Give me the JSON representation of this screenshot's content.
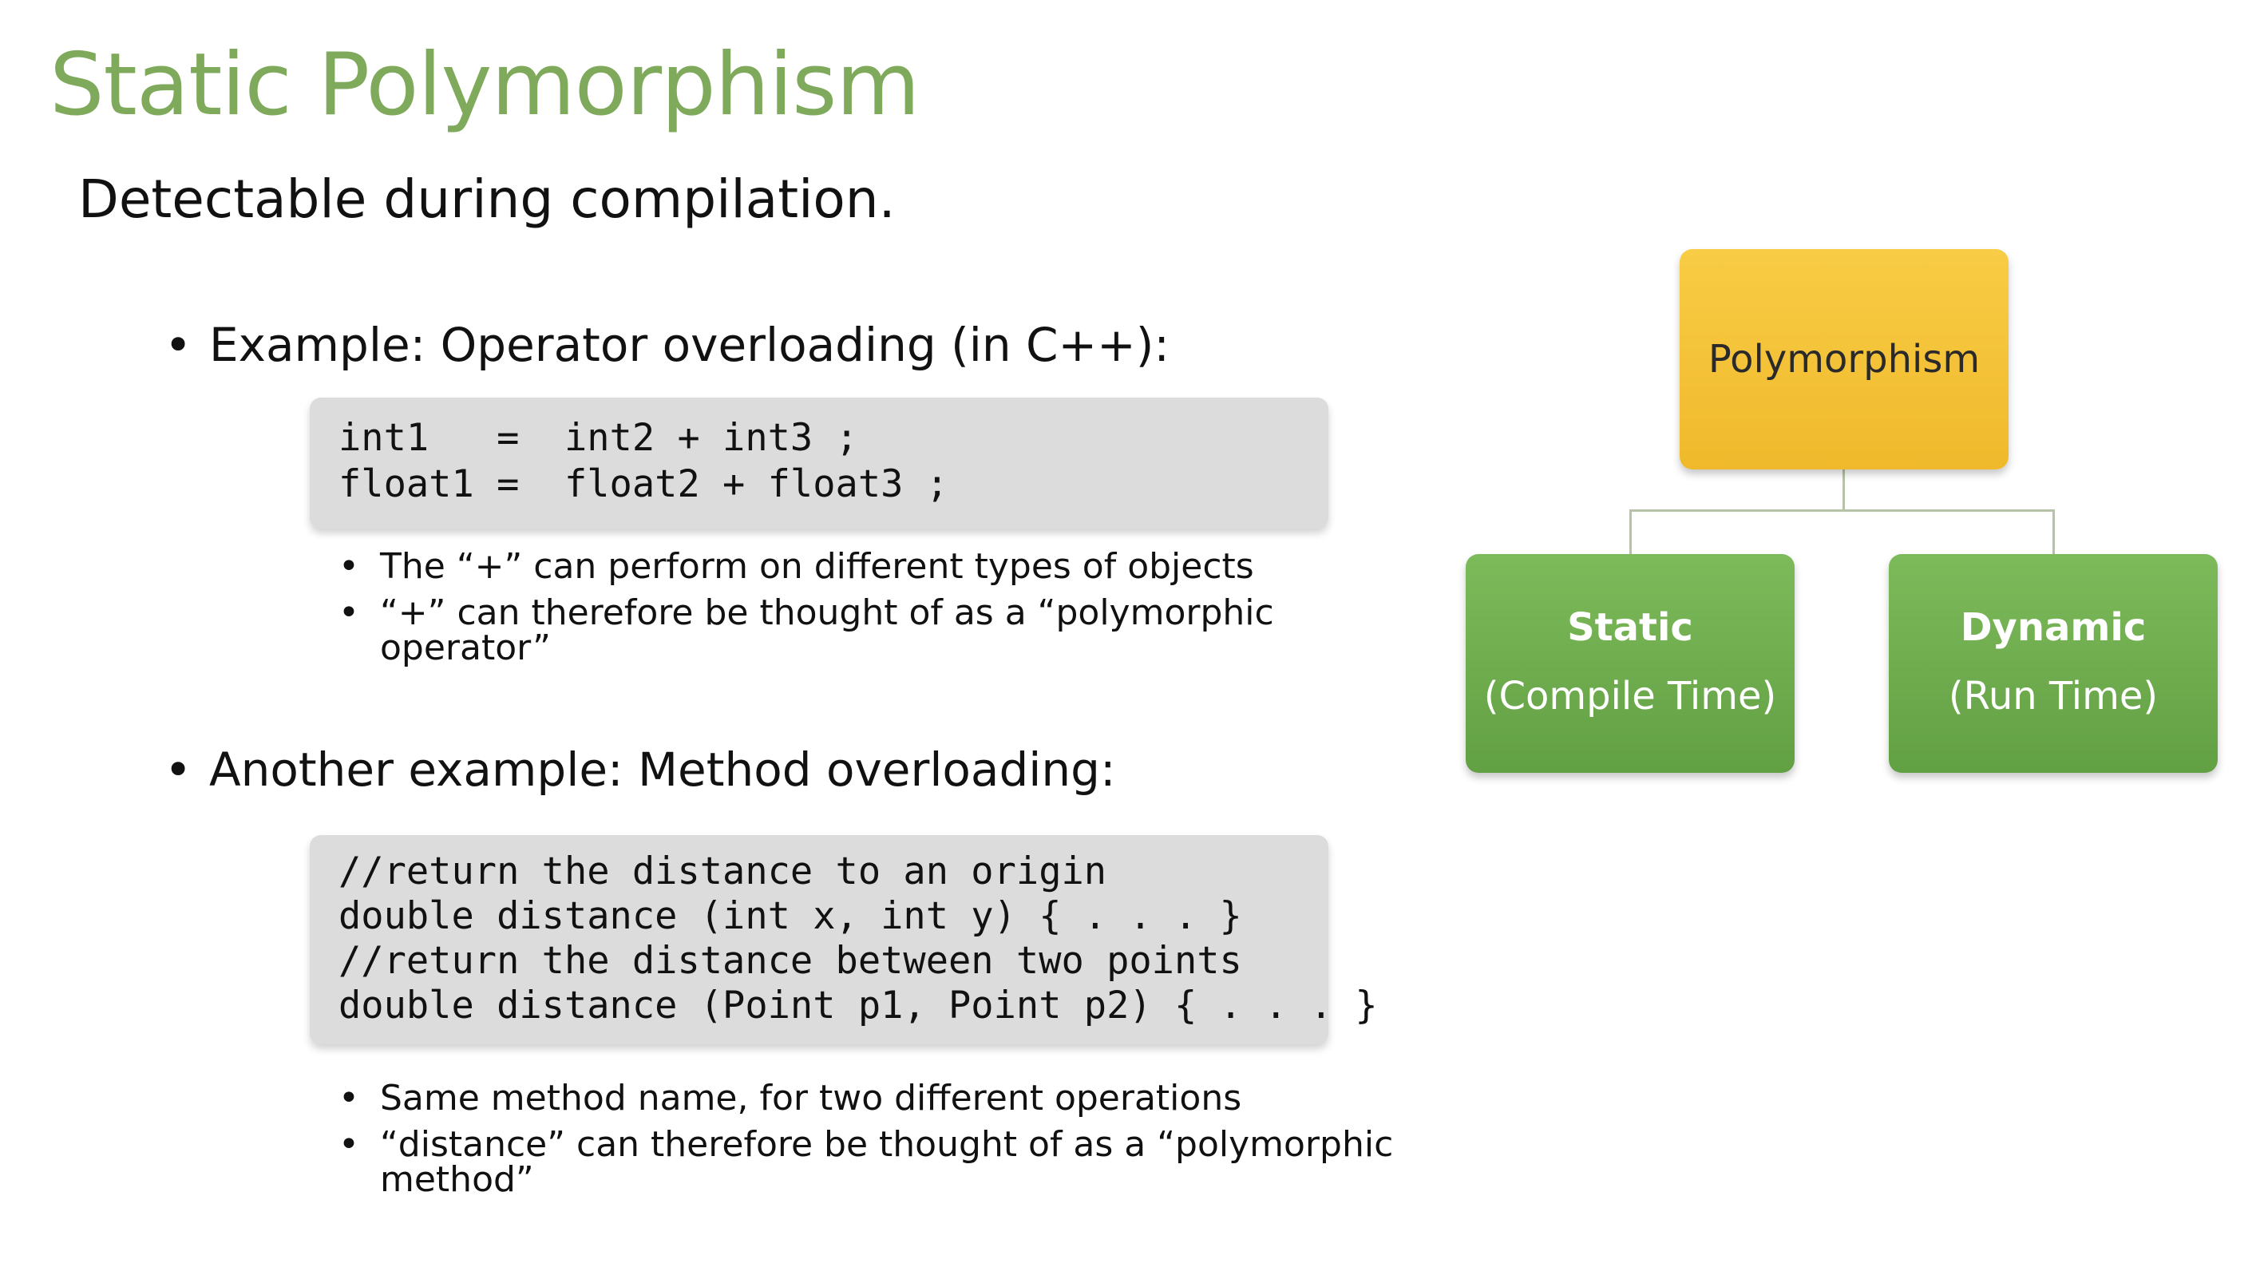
{
  "slide": {
    "title": "Static Polymorphism",
    "subtitle": "Detectable during compilation."
  },
  "example1": {
    "bullet": "•",
    "label": "Example:   Operator overloading (in C++):",
    "code_lines": [
      "int1   =  int2 + int3 ;",
      "float1 =  float2 + float3 ;"
    ],
    "notes": [
      {
        "bullet": "•",
        "text": "The  “+”  can perform on different types of objects",
        "cont": ""
      },
      {
        "bullet": "•",
        "text": "“+” can therefore be thought of as a “polymorphic",
        "cont": "operator”"
      }
    ]
  },
  "example2": {
    "bullet": "•",
    "label": "Another example: Method overloading:",
    "code_lines": [
      "//return the distance to an origin",
      "double distance (int x, int y) { . . . }",
      "//return the distance between two points",
      "double distance (Point p1, Point p2) { . . . }"
    ],
    "notes": [
      {
        "bullet": "•",
        "text": "Same method name, for two different operations",
        "cont": ""
      },
      {
        "bullet": "•",
        "text": "“distance” can therefore be thought of as a “polymorphic",
        "cont": "method”"
      }
    ]
  },
  "diagram": {
    "root": "Polymorphism",
    "children": [
      {
        "label": "Static",
        "sub": "(Compile Time)"
      },
      {
        "label": "Dynamic",
        "sub": "(Run Time)"
      }
    ],
    "colors": {
      "title": "#7faa5c",
      "root_fill": "#f2be30",
      "child_fill": "#6aa84f",
      "connector": "#b7c3a7",
      "code_box": "#dcdcdc"
    }
  }
}
